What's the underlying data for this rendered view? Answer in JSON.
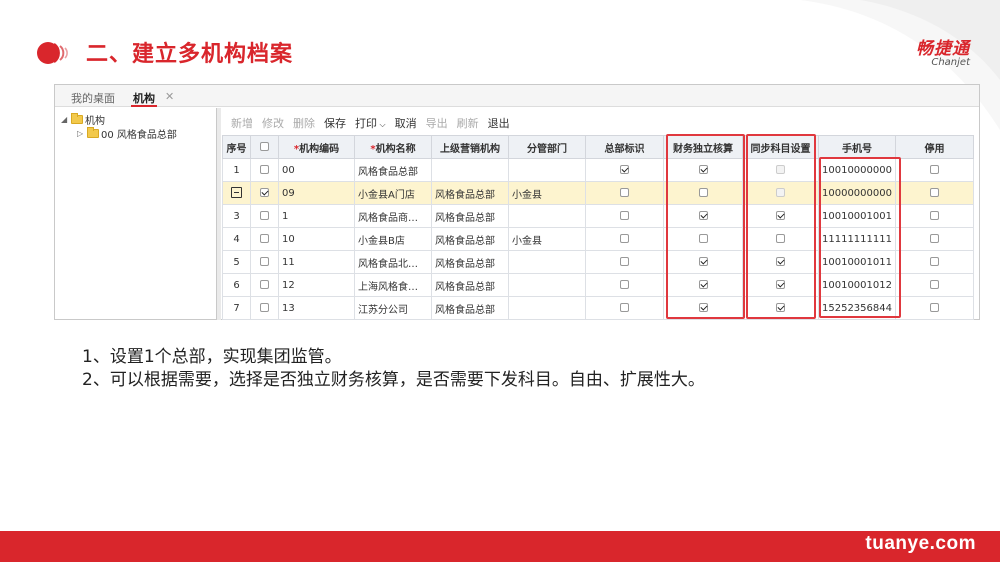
{
  "slide": {
    "title": "二、建立多机构档案",
    "brand_cn": "畅捷通",
    "brand_en": "Chanjet",
    "footer": "tuanye.com",
    "accent_color": "#d9262c"
  },
  "tabs": {
    "home": "我的桌面",
    "active": "机构",
    "close_icon": "close-icon"
  },
  "tree": {
    "root": "机构",
    "child": "00 风格食品总部"
  },
  "toolbar": {
    "add": "新增",
    "edit": "修改",
    "delete": "删除",
    "save": "保存",
    "print": "打印",
    "cancel": "取消",
    "export": "导出",
    "refresh": "刷新",
    "exit": "退出"
  },
  "grid": {
    "headers": {
      "seq": "序号",
      "code": "机构编码",
      "name": "机构名称",
      "parent": "上级营销机构",
      "dept": "分管部门",
      "hq": "总部标识",
      "finance": "财务独立核算",
      "sync": "同步科目设置",
      "phone": "手机号",
      "disabled": "停用"
    },
    "rows": [
      {
        "seq": "1",
        "code": "00",
        "name": "风格食品总部",
        "parent": "",
        "dept": "",
        "hq": true,
        "finance": true,
        "sync": false,
        "phone": "10010000000",
        "disabled": false
      },
      {
        "seq": "",
        "code": "09",
        "name": "小金县A门店",
        "parent": "风格食品总部",
        "dept": "小金县",
        "hq": false,
        "finance": false,
        "sync": false,
        "phone": "10000000000",
        "disabled": false
      },
      {
        "seq": "3",
        "code": "1",
        "name": "风格食品商…",
        "parent": "风格食品总部",
        "dept": "",
        "hq": false,
        "finance": true,
        "sync": true,
        "phone": "10010001001",
        "disabled": false
      },
      {
        "seq": "4",
        "code": "10",
        "name": "小金县B店",
        "parent": "风格食品总部",
        "dept": "小金县",
        "hq": false,
        "finance": false,
        "sync": false,
        "phone": "11111111111",
        "disabled": false
      },
      {
        "seq": "5",
        "code": "11",
        "name": "风格食品北…",
        "parent": "风格食品总部",
        "dept": "",
        "hq": false,
        "finance": true,
        "sync": true,
        "phone": "10010001011",
        "disabled": false
      },
      {
        "seq": "6",
        "code": "12",
        "name": "上海风格食…",
        "parent": "风格食品总部",
        "dept": "",
        "hq": false,
        "finance": true,
        "sync": true,
        "phone": "10010001012",
        "disabled": false
      },
      {
        "seq": "7",
        "code": "13",
        "name": "江苏分公司",
        "parent": "风格食品总部",
        "dept": "",
        "hq": false,
        "finance": true,
        "sync": true,
        "phone": "15252356844",
        "disabled": false
      }
    ]
  },
  "notes": [
    "1、设置1个总部，实现集团监管。",
    "2、可以根据需要，选择是否独立财务核算，是否需要下发科目。自由、扩展性大。"
  ]
}
